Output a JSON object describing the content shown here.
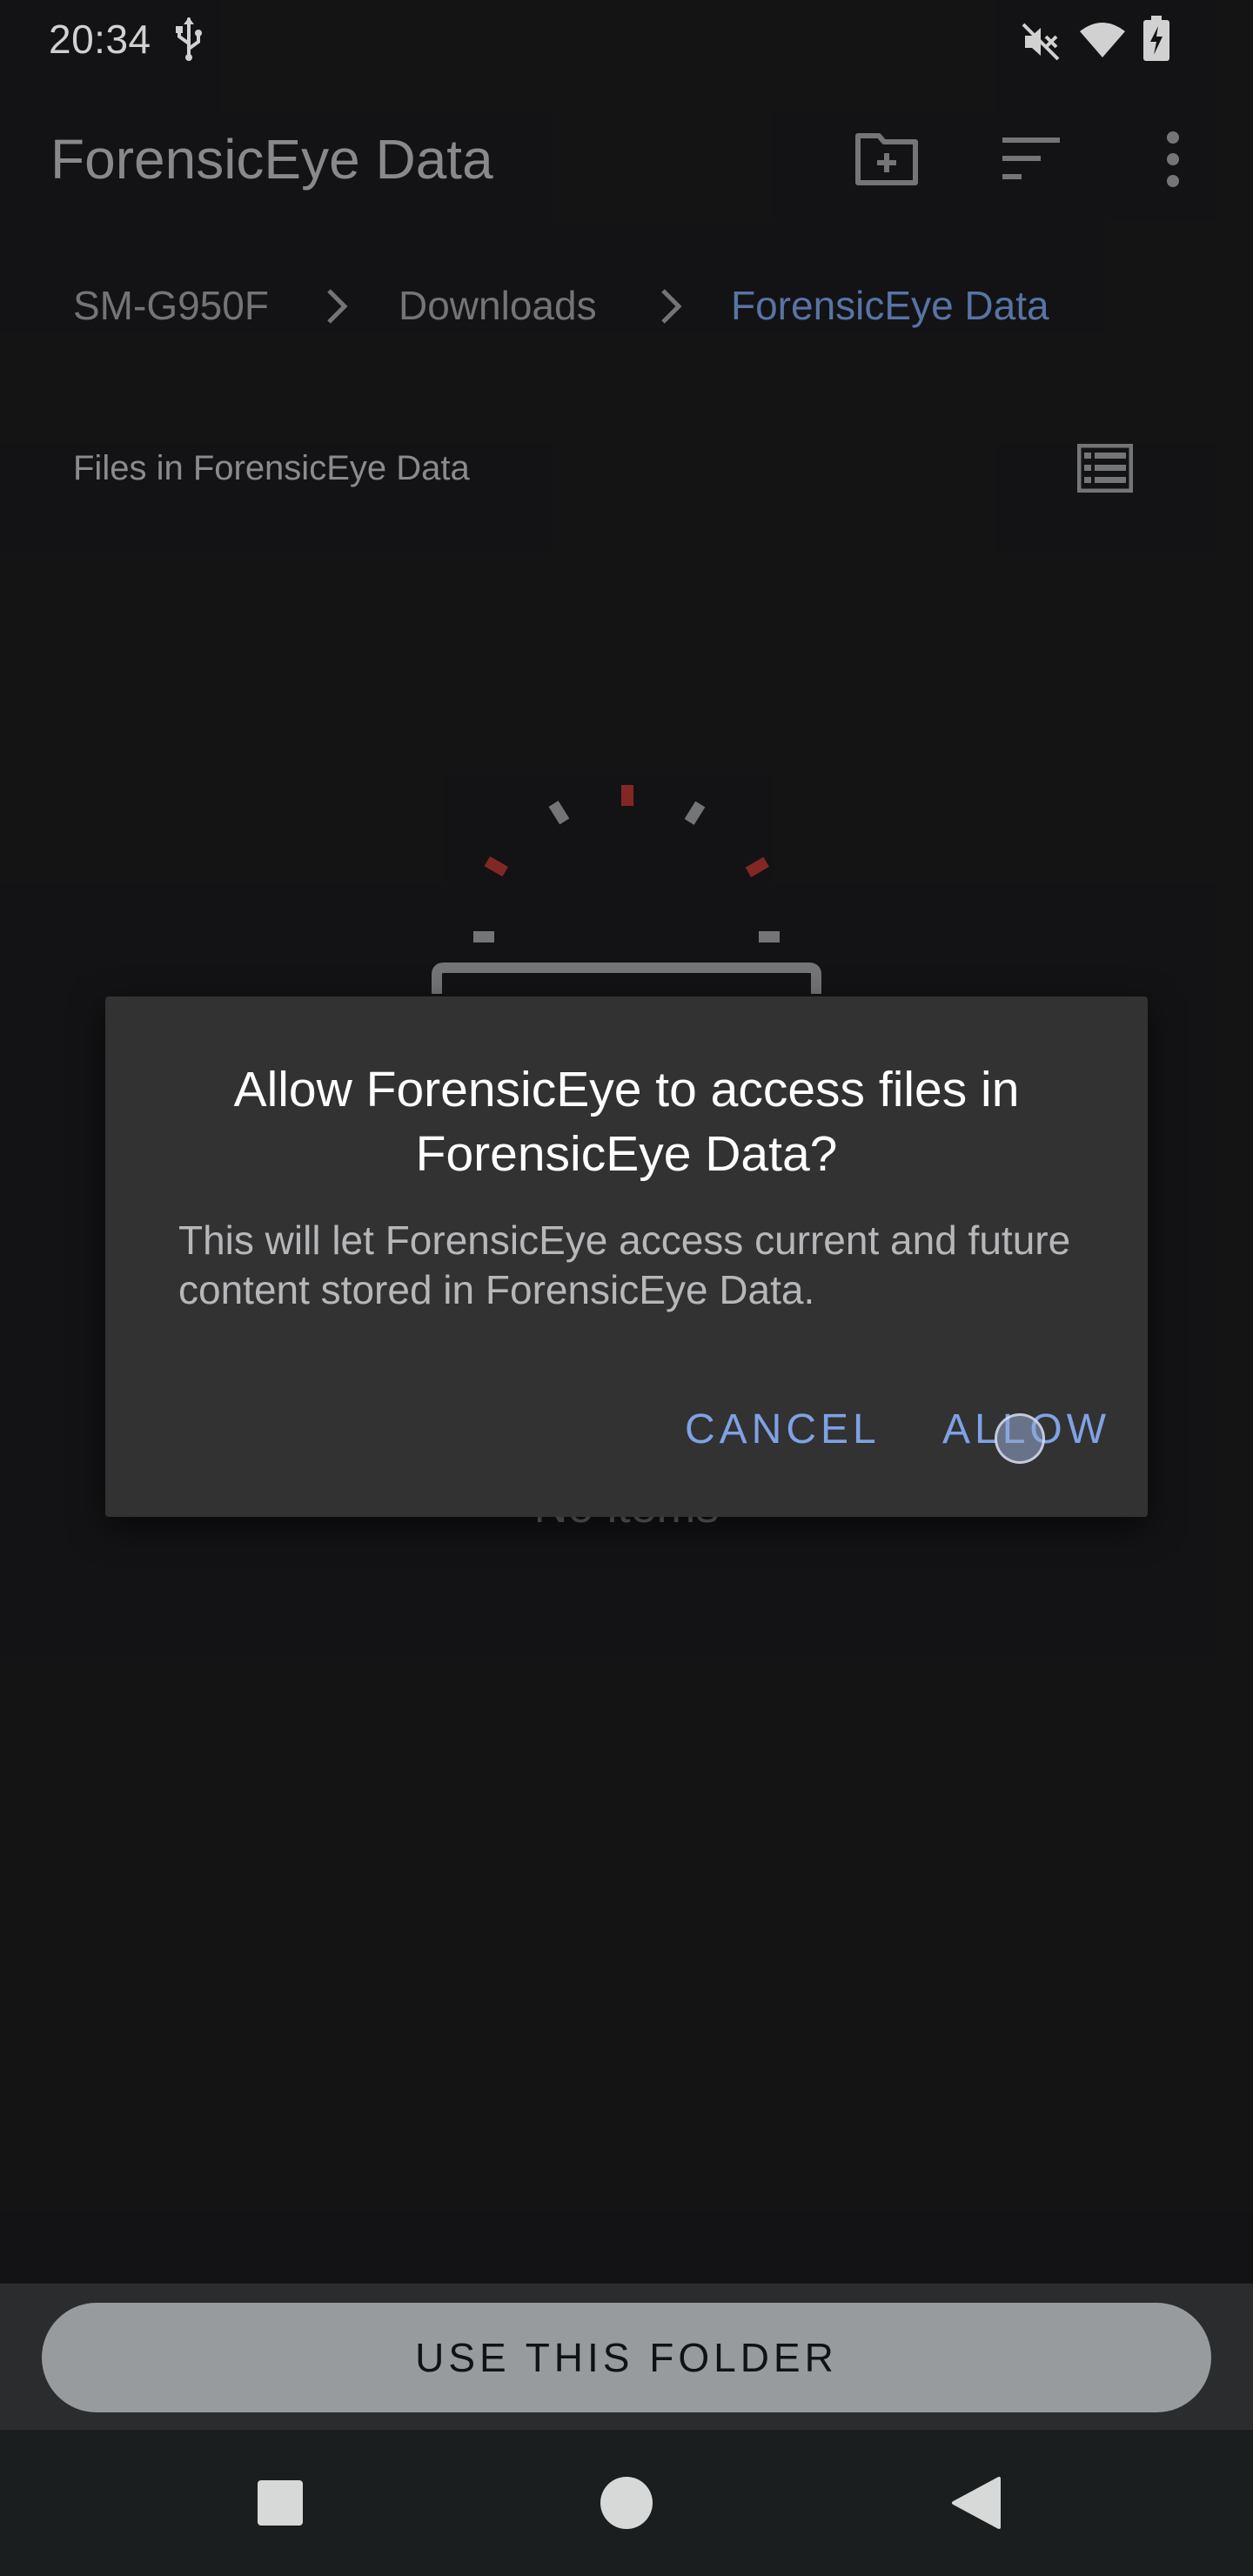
{
  "status_bar": {
    "time": "20:34",
    "icons": [
      "usb-icon",
      "mute-icon",
      "wifi-icon",
      "battery-charging-icon"
    ]
  },
  "app_bar": {
    "title": "ForensicEye Data",
    "actions": [
      "new-folder-icon",
      "sort-icon",
      "more-vert-icon"
    ]
  },
  "breadcrumb": {
    "items": [
      {
        "label": "SM-G950F"
      },
      {
        "label": "Downloads"
      },
      {
        "label": "ForensicEye Data"
      }
    ]
  },
  "list": {
    "header": "Files in ForensicEye Data",
    "empty_text": "No items"
  },
  "dialog": {
    "title": "Allow ForensicEye to access files in ForensicEye Data?",
    "message": "This will let ForensicEye access current and future content stored in ForensicEye Data.",
    "cancel_label": "CANCEL",
    "allow_label": "ALLOW"
  },
  "bottom": {
    "use_folder_label": "USE THIS FOLDER"
  },
  "colors": {
    "background": "#18181a",
    "dialog": "#323233",
    "accent": "#7fa2e4",
    "breadcrumb_current": "#6c8ec9",
    "illustration_red": "#a0302d"
  }
}
